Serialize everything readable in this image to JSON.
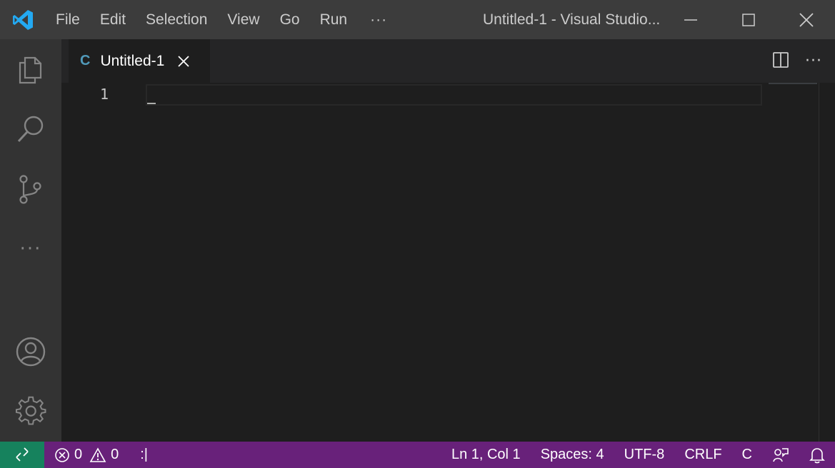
{
  "titlebar": {
    "menu": [
      "File",
      "Edit",
      "Selection",
      "View",
      "Go",
      "Run"
    ],
    "more": "···",
    "window_title": "Untitled-1 - Visual Studio..."
  },
  "icons": {
    "logo": "vscode-logo-icon",
    "explorer": "files-icon",
    "search": "search-icon",
    "scm": "source-control-icon",
    "more": "more-icon",
    "accounts": "account-icon",
    "manage": "gear-icon"
  },
  "activitybar": {
    "more": "···"
  },
  "tab": {
    "lang": "C",
    "label": "Untitled-1"
  },
  "editor": {
    "line_numbers": [
      "1"
    ],
    "actions_more": "···"
  },
  "statusbar": {
    "errors": "0",
    "warnings": "0",
    "vim_indicator": ":|",
    "position": "Ln 1, Col 1",
    "spaces": "Spaces: 4",
    "encoding": "UTF-8",
    "eol": "CRLF",
    "language": "C"
  },
  "colors": {
    "titlebar": "#3c3c3c",
    "activitybar": "#333333",
    "editor": "#1e1e1e",
    "statusbar": "#68217a",
    "remote": "#16825d",
    "vscode_blue": "#23a9f2",
    "c_lang": "#519aba"
  }
}
